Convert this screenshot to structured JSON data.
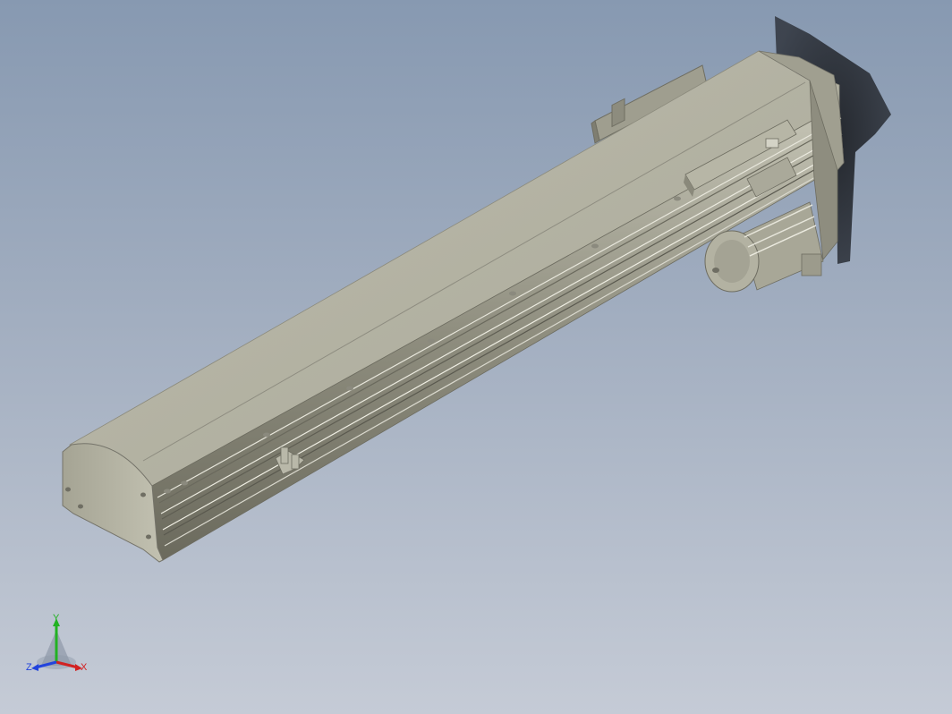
{
  "viewport": {
    "background_top": "#8799b1",
    "background_bottom": "#c5cbd6"
  },
  "model": {
    "description_icon": "linear-module-actuator-icon",
    "body_color": "#a9a898",
    "top_color": "#b4b3a3",
    "shadow_color": "#1e2126"
  },
  "triad": {
    "x_label": "X",
    "y_label": "Y",
    "z_label": "Z",
    "x_color": "#d22222",
    "y_color": "#22b222",
    "z_color": "#2244dd"
  }
}
